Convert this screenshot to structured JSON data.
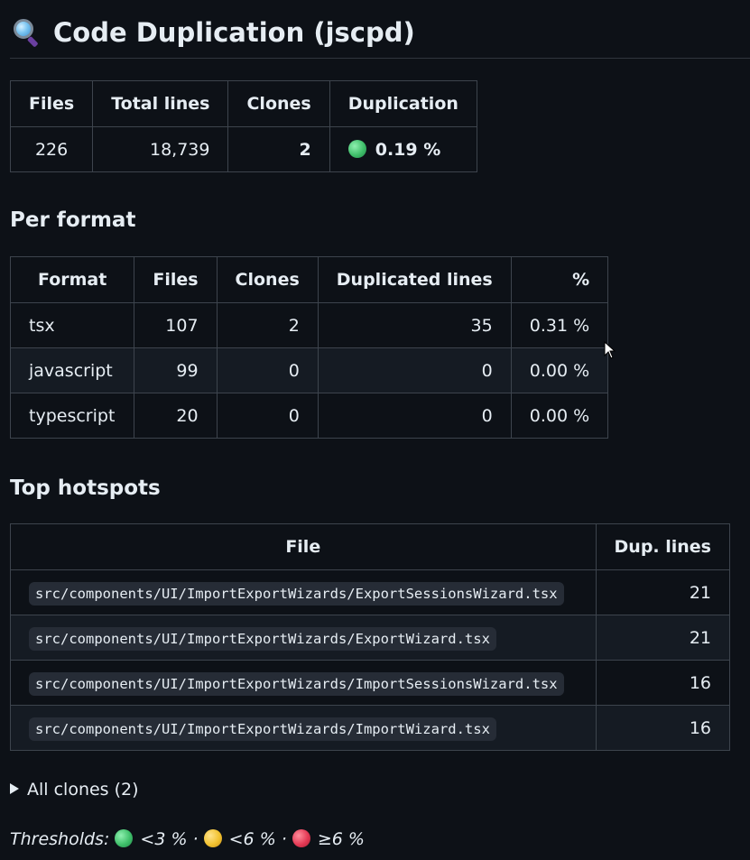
{
  "title": "Code Duplication (jscpd)",
  "title_icon": "magnifying-glass-icon",
  "summary": {
    "headers": [
      "Files",
      "Total lines",
      "Clones",
      "Duplication"
    ],
    "row": {
      "files": "226",
      "total_lines": "18,739",
      "clones": "2",
      "duplication": "0.19 %",
      "status_color": "green"
    }
  },
  "per_format": {
    "heading": "Per format",
    "headers": [
      "Format",
      "Files",
      "Clones",
      "Duplicated lines",
      "%"
    ],
    "rows": [
      {
        "format": "tsx",
        "files": "107",
        "clones": "2",
        "dup_lines": "35",
        "pct": "0.31 %"
      },
      {
        "format": "javascript",
        "files": "99",
        "clones": "0",
        "dup_lines": "0",
        "pct": "0.00 %"
      },
      {
        "format": "typescript",
        "files": "20",
        "clones": "0",
        "dup_lines": "0",
        "pct": "0.00 %"
      }
    ]
  },
  "hotspots": {
    "heading": "Top hotspots",
    "headers": [
      "File",
      "Dup. lines"
    ],
    "rows": [
      {
        "file": "src/components/UI/ImportExportWizards/ExportSessionsWizard.tsx",
        "lines": "21"
      },
      {
        "file": "src/components/UI/ImportExportWizards/ExportWizard.tsx",
        "lines": "21"
      },
      {
        "file": "src/components/UI/ImportExportWizards/ImportSessionsWizard.tsx",
        "lines": "16"
      },
      {
        "file": "src/components/UI/ImportExportWizards/ImportWizard.tsx",
        "lines": "16"
      }
    ]
  },
  "all_clones": "All clones (2)",
  "thresholds": {
    "label": "Thresholds:",
    "green": "<3 % ·",
    "yellow": "<6 % ·",
    "red": "≥6 %"
  },
  "colors": {
    "background": "#0d1117",
    "green": "#3fbf6a",
    "yellow": "#f2c230",
    "red": "#e43a55"
  }
}
